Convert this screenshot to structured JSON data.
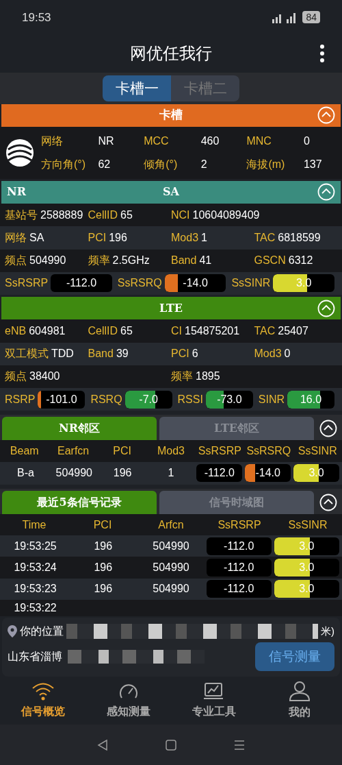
{
  "status_bar": {
    "time": "19:53",
    "battery": "84"
  },
  "app_bar": {
    "title": "网优任我行"
  },
  "sim_tabs": [
    {
      "label": "卡槽一",
      "selected": true
    },
    {
      "label": "卡槽二",
      "selected": false
    }
  ],
  "sim_section": {
    "title": "卡槽",
    "expanded": true,
    "rows": [
      [
        {
          "label": "网络",
          "value": "NR"
        },
        {
          "label": "MCC",
          "value": "460"
        },
        {
          "label": "MNC",
          "value": "0"
        }
      ],
      [
        {
          "label": "方向角(°)",
          "value": "62"
        },
        {
          "label": "倾角(°)",
          "value": "2"
        },
        {
          "label": "海拔(m)",
          "value": "137"
        }
      ]
    ]
  },
  "nr_section": {
    "left": "NR",
    "title": "SA",
    "expanded": true,
    "rows": [
      [
        {
          "label": "基站号",
          "value": "2588889"
        },
        {
          "label": "CellID",
          "value": "65"
        },
        {
          "label": "NCI",
          "value": "10604089409"
        }
      ],
      [
        {
          "label": "网络",
          "value": "SA"
        },
        {
          "label": "PCI",
          "value": "196"
        },
        {
          "label": "Mod3",
          "value": "1"
        },
        {
          "label": "TAC",
          "value": "6818599"
        }
      ],
      [
        {
          "label": "频点",
          "value": "504990"
        },
        {
          "label": "频率",
          "value": "2.5GHz"
        },
        {
          "label": "Band",
          "value": "41"
        },
        {
          "label": "GSCN",
          "value": "6312"
        }
      ]
    ],
    "metrics": [
      {
        "label": "SsRSRP",
        "value": "-112.0"
      },
      {
        "label": "SsRSRQ",
        "value": "-14.0",
        "level": 0.22,
        "color": "#e07020"
      },
      {
        "label": "SsSINR",
        "value": "3.0",
        "level": 0.55,
        "color": "#d8d830"
      }
    ]
  },
  "lte_section": {
    "title": "LTE",
    "expanded": true,
    "rows": [
      [
        {
          "label": "eNB",
          "value": "604981"
        },
        {
          "label": "CellID",
          "value": "65"
        },
        {
          "label": "CI",
          "value": "154875201"
        },
        {
          "label": "TAC",
          "value": "25407"
        }
      ],
      [
        {
          "label": "双工模式",
          "value": "TDD"
        },
        {
          "label": "Band",
          "value": "39"
        },
        {
          "label": "PCI",
          "value": "6"
        },
        {
          "label": "Mod3",
          "value": "0"
        }
      ],
      [
        {
          "label": "频点",
          "value": "38400"
        },
        null,
        {
          "label": "频率",
          "value": "1895"
        }
      ]
    ],
    "metrics": [
      {
        "label": "RSRP",
        "value": "-101.0",
        "level": 0.06,
        "color": "#e07020"
      },
      {
        "label": "RSRQ",
        "value": "-7.0",
        "level": 0.65,
        "color": "#2a9a40"
      },
      {
        "label": "RSSI",
        "value": "-73.0",
        "level": 0.38,
        "color": "#2a9a40"
      },
      {
        "label": "SINR",
        "value": "16.0",
        "level": 0.7,
        "color": "#2a9a40"
      }
    ]
  },
  "neighbor_tabs": [
    {
      "label": "NR邻区",
      "selected": true
    },
    {
      "label": "LTE邻区",
      "selected": false
    }
  ],
  "neighbor_expanded": true,
  "neighbor_table": {
    "columns": [
      "Beam",
      "Earfcn",
      "PCI",
      "Mod3",
      "SsRSRP",
      "SsRSRQ",
      "SsSINR"
    ],
    "rows": [
      {
        "beam": "B-a",
        "earfcn": "504990",
        "pci": "196",
        "mod3": "1",
        "metrics": [
          {
            "value": "-112.0"
          },
          {
            "value": "-14.0",
            "level": 0.22,
            "color": "#e07020"
          },
          {
            "value": "3.0",
            "level": 0.55,
            "color": "#d8d830"
          }
        ]
      }
    ]
  },
  "record_tabs": [
    {
      "label": "最近5条信号记录",
      "selected": true
    },
    {
      "label": "信号时域图",
      "selected": false
    }
  ],
  "record_expanded": true,
  "record_table": {
    "columns": [
      "Time",
      "PCI",
      "Arfcn",
      "SsRSRP",
      "SsSINR"
    ],
    "rows": [
      {
        "time": "19:53:25",
        "pci": "196",
        "arfcn": "504990",
        "rsrp": {
          "value": "-112.0"
        },
        "sinr": {
          "value": "3.0",
          "level": 0.55,
          "color": "#d8d830"
        }
      },
      {
        "time": "19:53:24",
        "pci": "196",
        "arfcn": "504990",
        "rsrp": {
          "value": "-112.0"
        },
        "sinr": {
          "value": "3.0",
          "level": 0.55,
          "color": "#d8d830"
        }
      },
      {
        "time": "19:53:23",
        "pci": "196",
        "arfcn": "504990",
        "rsrp": {
          "value": "-112.0"
        },
        "sinr": {
          "value": "3.0",
          "level": 0.55,
          "color": "#d8d830"
        }
      },
      {
        "time": "19:53:22"
      }
    ]
  },
  "location": {
    "label": "你的位置",
    "suffix": "米)",
    "address": "山东省淄博",
    "button": "信号测量"
  },
  "bottom_nav": [
    {
      "label": "信号概览",
      "kind": "wifi",
      "selected": true
    },
    {
      "label": "感知测量",
      "kind": "gauge",
      "selected": false
    },
    {
      "label": "专业工具",
      "kind": "laptop",
      "selected": false
    },
    {
      "label": "我的",
      "kind": "person",
      "selected": false
    }
  ]
}
